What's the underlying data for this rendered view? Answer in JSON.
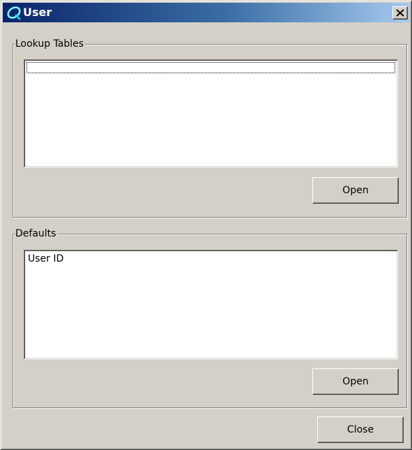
{
  "window": {
    "title": "User",
    "close_glyph": "✕"
  },
  "lookup_tables": {
    "label": "Lookup Tables",
    "items": [],
    "open_label": "Open"
  },
  "defaults": {
    "label": "Defaults",
    "items": [
      "User ID"
    ],
    "open_label": "Open"
  },
  "footer": {
    "close_label": "Close"
  },
  "icons": {
    "app": "app-logo-icon",
    "close": "close-icon"
  },
  "colors": {
    "face": "#d4d0c8",
    "title_start": "#0a246a",
    "title_end": "#a6caf0"
  }
}
